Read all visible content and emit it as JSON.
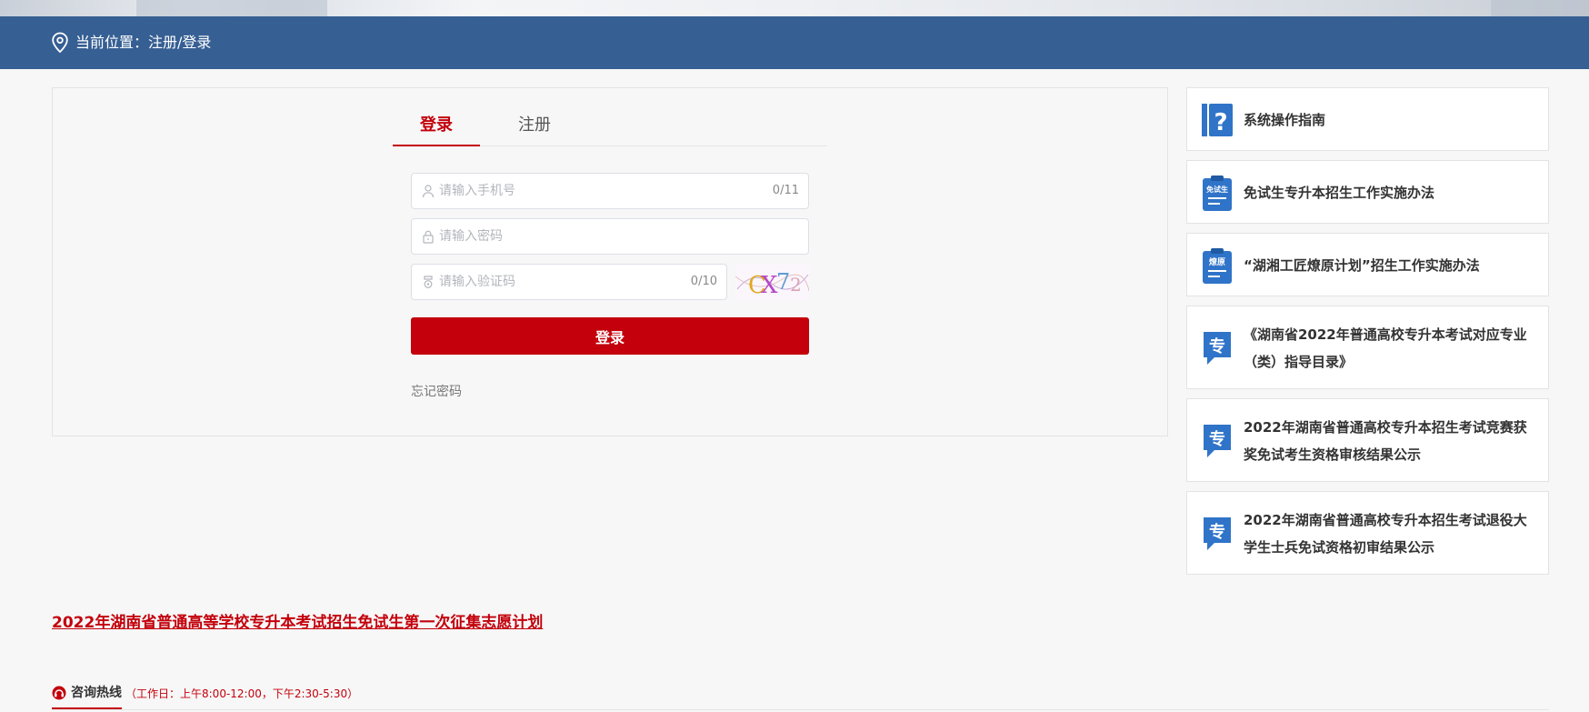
{
  "breadcrumb": {
    "text": "当前位置：注册/登录"
  },
  "tabs": [
    {
      "label": "登录"
    },
    {
      "label": "注册"
    }
  ],
  "form": {
    "phone": {
      "placeholder": "请输入手机号",
      "value": "",
      "count": "0/11"
    },
    "password": {
      "placeholder": "请输入密码",
      "value": ""
    },
    "captcha": {
      "placeholder": "请输入验证码",
      "value": "",
      "count": "0/10"
    },
    "captcha_image": {
      "text": "CX72"
    },
    "login_button": "登录",
    "forgot": "忘记密码"
  },
  "sidebar": {
    "items": [
      {
        "label": "系统操作指南",
        "icon": "help-book-icon",
        "icon_text": "?"
      },
      {
        "label": "免试生专升本招生工作实施办法",
        "icon": "clipboard-icon",
        "icon_text": "免试生"
      },
      {
        "label": "“湖湘工匠燎原计划”招生工作实施办法",
        "icon": "clipboard-icon",
        "icon_text": "燎原"
      },
      {
        "label": "《湖南省2022年普通高校专升本考试对应专业（类）指导目录》",
        "icon": "speech-bubble-icon",
        "icon_text": "专"
      },
      {
        "label": "2022年湖南省普通高校专升本招生考试竞赛获奖免试考生资格审核结果公示",
        "icon": "speech-bubble-icon",
        "icon_text": "专"
      },
      {
        "label": "2022年湖南省普通高校专升本招生考试退役大学生士兵免试资格初审结果公示",
        "icon": "speech-bubble-icon",
        "icon_text": "专"
      }
    ]
  },
  "notice": {
    "text": "2022年湖南省普通高等学校专升本考试招生免试生第一次征集志愿计划"
  },
  "hotline": {
    "label": "咨询热线",
    "hours": "（工作日：上午8:00-12:00，下午2:30-5:30）"
  },
  "colors": {
    "header_bar": "#365f93",
    "accent_red": "#c3000b",
    "icon_blue": "#2f74c8"
  }
}
